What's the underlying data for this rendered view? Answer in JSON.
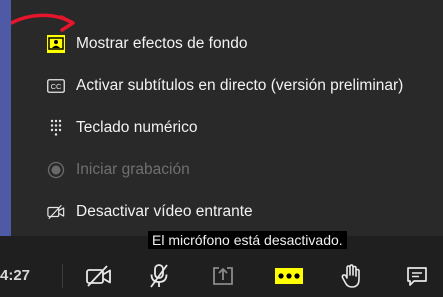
{
  "menu": {
    "items": [
      {
        "label": "Mostrar efectos de fondo",
        "icon": "background-effects-icon",
        "enabled": true
      },
      {
        "label": "Activar subtítulos en directo (versión preliminar)",
        "icon": "cc-icon",
        "enabled": true
      },
      {
        "label": "Teclado numérico",
        "icon": "dialpad-icon",
        "enabled": true
      },
      {
        "label": "Iniciar grabación",
        "icon": "record-icon",
        "enabled": false
      },
      {
        "label": "Desactivar vídeo entrante",
        "icon": "video-off-icon",
        "enabled": true
      }
    ]
  },
  "status": {
    "mic_notice": "El micrófono está desactivado.",
    "call_time": "4:27"
  },
  "toolbar": {
    "buttons": [
      "camera-off",
      "mic-off",
      "share",
      "more-actions",
      "raise-hand",
      "chat"
    ]
  },
  "colors": {
    "accent_yellow": "#ffff00",
    "annotation_red": "#e5162c",
    "menu_bg": "#292929"
  }
}
